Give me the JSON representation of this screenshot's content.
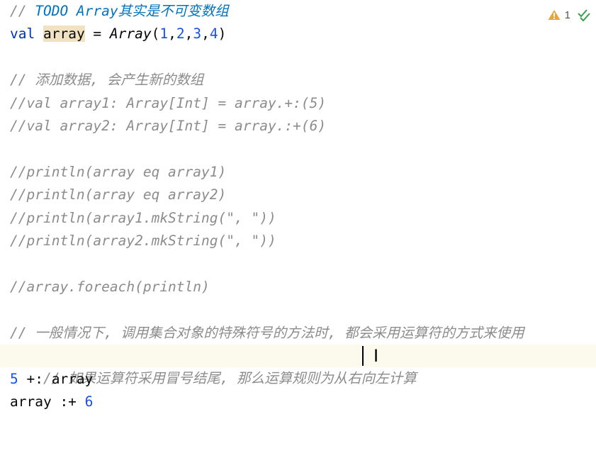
{
  "status": {
    "warning_count": "1"
  },
  "lines": {
    "l1": {
      "a": "// ",
      "b": "TODO Array",
      "c": "其实是不可变数组"
    },
    "l2": {
      "a": "val",
      "b": " ",
      "c": "array",
      "d": " = ",
      "e": "Array",
      "f": "(",
      "g": "1",
      "h": ",",
      "i": "2",
      "j": ",",
      "k": "3",
      "l": ",",
      "m": "4",
      "n": ")"
    },
    "l4": "// 添加数据, 会产生新的数组",
    "l5": "//val array1: Array[Int] = array.+:(5)",
    "l6": "//val array2: Array[Int] = array.:+(6)",
    "l8": "//println(array eq array1)",
    "l9": "//println(array eq array2)",
    "l10": "//println(array1.mkString(\", \"))",
    "l11": "//println(array2.mkString(\", \"))",
    "l13": "//array.foreach(println)",
    "l15": "// 一般情况下, 调用集合对象的特殊符号的方法时, 都会采用运算符的方式来使用",
    "l16": "// 如果运算符采用冒号结尾, 那么运算规则为从右向左计算",
    "l17": {
      "a": "5",
      "b": " +: array"
    },
    "l18": {
      "a": "array :+ ",
      "b": "6"
    }
  }
}
